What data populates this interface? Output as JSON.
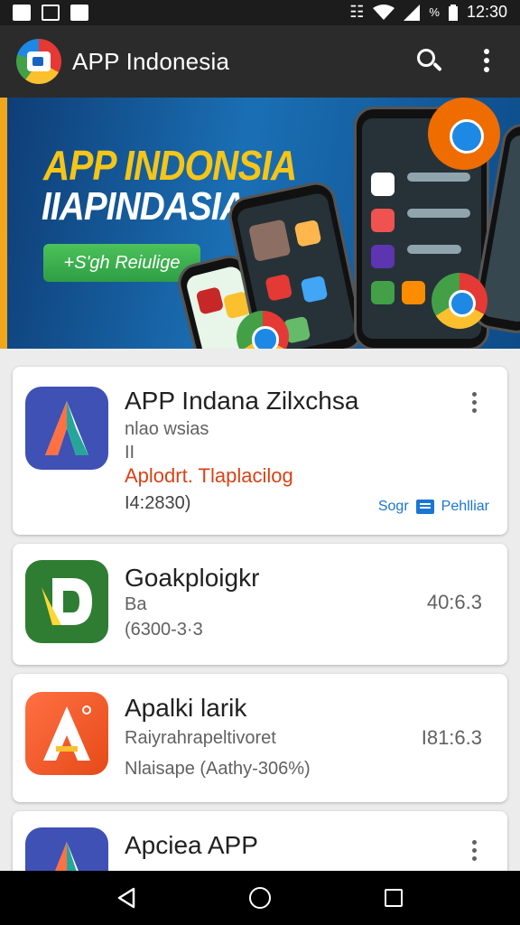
{
  "status_bar": {
    "time": "12:30",
    "battery_text": "%",
    "icons": [
      "photo-icon",
      "check-square-icon",
      "image-icon",
      "vibrate-icon",
      "wifi-icon",
      "signal-icon",
      "battery-icon"
    ]
  },
  "app_bar": {
    "title": "APP Indonesia",
    "icons": [
      "app-logo-icon",
      "search-icon",
      "more-vert-icon"
    ]
  },
  "banner": {
    "headline_1": "APP INDONSIA",
    "headline_2": "IIAPINDASIA",
    "button_label": "+S'gh Reiulige"
  },
  "cards": [
    {
      "title": "APP Indana Zilxchsa",
      "line1": "nlao wsias",
      "line2": "II",
      "developer": "Aplodrt. Tlaplacilog",
      "meta": "I4:2830)",
      "action_label": "Sogr",
      "action2_label": "Pehlliar"
    },
    {
      "title": "Goakploigkr",
      "line1": "Ba",
      "line2": "(6300-3·3",
      "value": "40:6.3"
    },
    {
      "title": "Apalki larik",
      "line1": "Raiyrahrapeltivoret",
      "line2": "Nlaisape (Aathy-306%)",
      "value": "I81:6.3"
    },
    {
      "title": "Apciea APP"
    }
  ],
  "colors": {
    "app_bar": "#2b2b2b",
    "banner_accent": "#f5c518",
    "developer_text": "#d84315",
    "action_text": "#1976d2"
  }
}
